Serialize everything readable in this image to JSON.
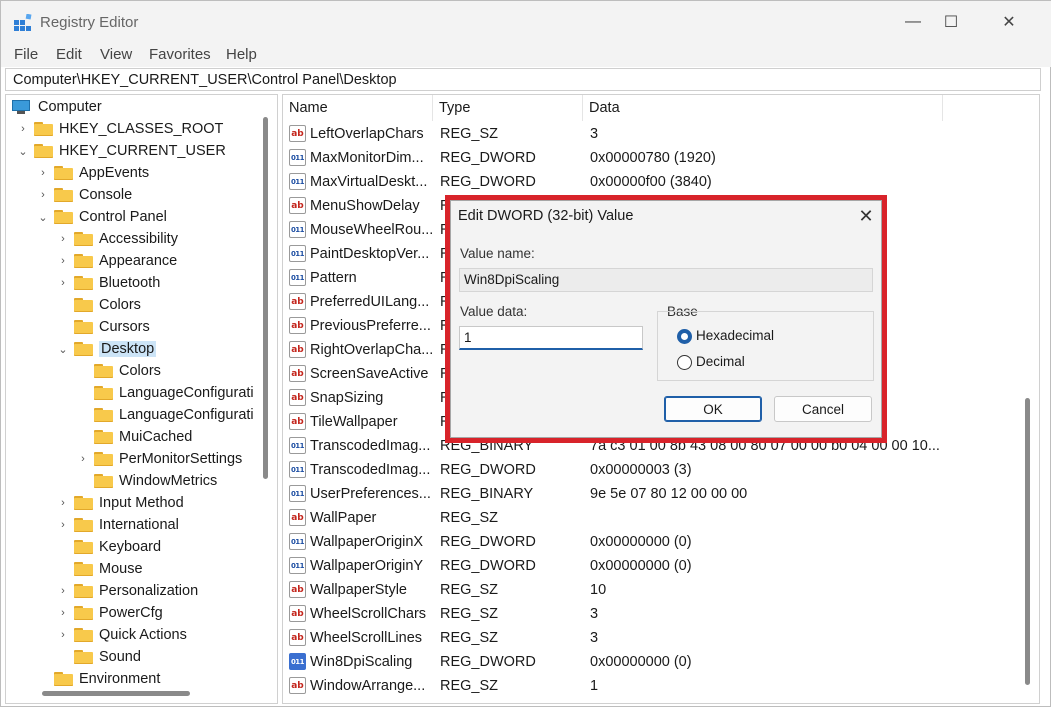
{
  "window": {
    "title": "Registry Editor",
    "minimize_glyph": "—",
    "maximize_glyph": "☐",
    "close_glyph": "✕"
  },
  "menu": [
    "File",
    "Edit",
    "View",
    "Favorites",
    "Help"
  ],
  "address": "Computer\\HKEY_CURRENT_USER\\Control Panel\\Desktop",
  "tree": [
    {
      "label": "Computer",
      "level": 0,
      "chevron": "",
      "icon": "computer-icon"
    },
    {
      "label": "HKEY_CLASSES_ROOT",
      "level": 1,
      "chevron": "›"
    },
    {
      "label": "HKEY_CURRENT_USER",
      "level": 1,
      "chevron": "⌄"
    },
    {
      "label": "AppEvents",
      "level": 2,
      "chevron": "›"
    },
    {
      "label": "Console",
      "level": 2,
      "chevron": "›"
    },
    {
      "label": "Control Panel",
      "level": 2,
      "chevron": "⌄"
    },
    {
      "label": "Accessibility",
      "level": 3,
      "chevron": "›"
    },
    {
      "label": "Appearance",
      "level": 3,
      "chevron": "›"
    },
    {
      "label": "Bluetooth",
      "level": 3,
      "chevron": "›"
    },
    {
      "label": "Colors",
      "level": 3,
      "chevron": ""
    },
    {
      "label": "Cursors",
      "level": 3,
      "chevron": ""
    },
    {
      "label": "Desktop",
      "level": 3,
      "chevron": "⌄",
      "selected": true
    },
    {
      "label": "Colors",
      "level": 4,
      "chevron": ""
    },
    {
      "label": "LanguageConfigurati",
      "level": 4,
      "chevron": ""
    },
    {
      "label": "LanguageConfigurati",
      "level": 4,
      "chevron": ""
    },
    {
      "label": "MuiCached",
      "level": 4,
      "chevron": ""
    },
    {
      "label": "PerMonitorSettings",
      "level": 4,
      "chevron": "›"
    },
    {
      "label": "WindowMetrics",
      "level": 4,
      "chevron": ""
    },
    {
      "label": "Input Method",
      "level": 3,
      "chevron": "›"
    },
    {
      "label": "International",
      "level": 3,
      "chevron": "›"
    },
    {
      "label": "Keyboard",
      "level": 3,
      "chevron": ""
    },
    {
      "label": "Mouse",
      "level": 3,
      "chevron": ""
    },
    {
      "label": "Personalization",
      "level": 3,
      "chevron": "›"
    },
    {
      "label": "PowerCfg",
      "level": 3,
      "chevron": "›"
    },
    {
      "label": "Quick Actions",
      "level": 3,
      "chevron": "›"
    },
    {
      "label": "Sound",
      "level": 3,
      "chevron": ""
    },
    {
      "label": "Environment",
      "level": 2,
      "chevron": ""
    }
  ],
  "columns": {
    "name": "Name",
    "type": "Type",
    "data": "Data"
  },
  "values": [
    {
      "name": "LeftOverlapChars",
      "type": "REG_SZ",
      "data": "3",
      "icon": "sz"
    },
    {
      "name": "MaxMonitorDim...",
      "type": "REG_DWORD",
      "data": "0x00000780 (1920)",
      "icon": "bin"
    },
    {
      "name": "MaxVirtualDeskt...",
      "type": "REG_DWORD",
      "data": "0x00000f00 (3840)",
      "icon": "bin"
    },
    {
      "name": "MenuShowDelay",
      "type": "R",
      "data": "",
      "icon": "sz"
    },
    {
      "name": "MouseWheelRou...",
      "type": "R",
      "data": "",
      "icon": "bin"
    },
    {
      "name": "PaintDesktopVer...",
      "type": "R",
      "data": "",
      "icon": "bin"
    },
    {
      "name": "Pattern",
      "type": "R",
      "data": "",
      "icon": "bin"
    },
    {
      "name": "PreferredUILang...",
      "type": "R",
      "data": "",
      "icon": "sz"
    },
    {
      "name": "PreviousPreferre...",
      "type": "R",
      "data": "",
      "icon": "sz"
    },
    {
      "name": "RightOverlapCha...",
      "type": "R",
      "data": "",
      "icon": "sz"
    },
    {
      "name": "ScreenSaveActive",
      "type": "R",
      "data": "",
      "icon": "sz"
    },
    {
      "name": "SnapSizing",
      "type": "R",
      "data": "",
      "icon": "sz"
    },
    {
      "name": "TileWallpaper",
      "type": "R",
      "data": "",
      "icon": "sz"
    },
    {
      "name": "TranscodedImag...",
      "type": "REG_BINARY",
      "data": "7a c3 01 00 8b 43 08 00 80 07 00 00 b0 04 00 00 10...",
      "icon": "bin"
    },
    {
      "name": "TranscodedImag...",
      "type": "REG_DWORD",
      "data": "0x00000003 (3)",
      "icon": "bin"
    },
    {
      "name": "UserPreferences...",
      "type": "REG_BINARY",
      "data": "9e 5e 07 80 12 00 00 00",
      "icon": "bin"
    },
    {
      "name": "WallPaper",
      "type": "REG_SZ",
      "data": "",
      "icon": "sz"
    },
    {
      "name": "WallpaperOriginX",
      "type": "REG_DWORD",
      "data": "0x00000000 (0)",
      "icon": "bin"
    },
    {
      "name": "WallpaperOriginY",
      "type": "REG_DWORD",
      "data": "0x00000000 (0)",
      "icon": "bin"
    },
    {
      "name": "WallpaperStyle",
      "type": "REG_SZ",
      "data": "10",
      "icon": "sz"
    },
    {
      "name": "WheelScrollChars",
      "type": "REG_SZ",
      "data": "3",
      "icon": "sz"
    },
    {
      "name": "WheelScrollLines",
      "type": "REG_SZ",
      "data": "3",
      "icon": "sz"
    },
    {
      "name": "Win8DpiScaling",
      "type": "REG_DWORD",
      "data": "0x00000000 (0)",
      "icon": "bin",
      "highlight": true
    },
    {
      "name": "WindowArrange...",
      "type": "REG_SZ",
      "data": "1",
      "icon": "sz"
    }
  ],
  "dialog": {
    "title": "Edit DWORD (32-bit) Value",
    "close_glyph": "✕",
    "value_name_label": "Value name:",
    "value_name": "Win8DpiScaling",
    "value_data_label": "Value data:",
    "value_data": "1",
    "base_label": "Base",
    "hex_label": "Hexadecimal",
    "dec_label": "Decimal",
    "selected_base": "Hexadecimal",
    "ok_label": "OK",
    "cancel_label": "Cancel",
    "highlight_color": "#d8232a"
  }
}
